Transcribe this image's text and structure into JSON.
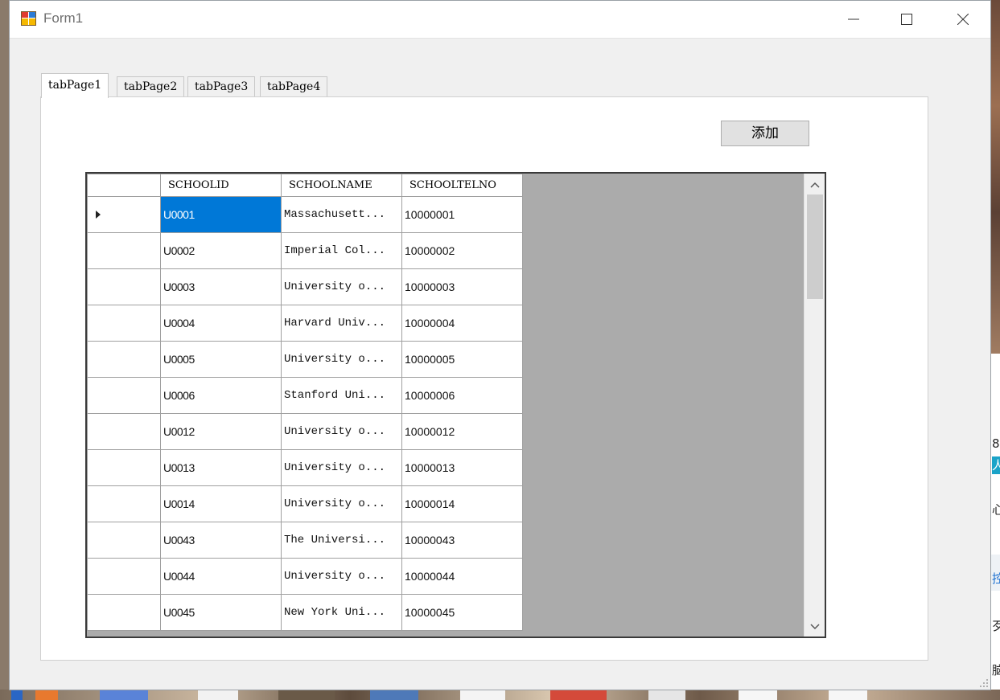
{
  "window": {
    "title": "Form1"
  },
  "tabs": [
    {
      "label": "tabPage1",
      "active": true
    },
    {
      "label": "tabPage2",
      "active": false
    },
    {
      "label": "tabPage3",
      "active": false
    },
    {
      "label": "tabPage4",
      "active": false
    }
  ],
  "toolbar": {
    "add_label": "添加"
  },
  "grid": {
    "columns": [
      "SCHOOLID",
      "SCHOOLNAME",
      "SCHOOLTELNO"
    ],
    "selected_row": 0,
    "selection_color": "#0078d7",
    "rows": [
      {
        "id": "U0001",
        "name": "Massachusett...",
        "tel": "10000001"
      },
      {
        "id": "U0002",
        "name": "Imperial Col...",
        "tel": "10000002"
      },
      {
        "id": "U0003",
        "name": "University o...",
        "tel": "10000003"
      },
      {
        "id": "U0004",
        "name": "Harvard Univ...",
        "tel": "10000004"
      },
      {
        "id": "U0005",
        "name": "University o...",
        "tel": "10000005"
      },
      {
        "id": "U0006",
        "name": "Stanford Uni...",
        "tel": "10000006"
      },
      {
        "id": "U0012",
        "name": "University o...",
        "tel": "10000012"
      },
      {
        "id": "U0013",
        "name": "University o...",
        "tel": "10000013"
      },
      {
        "id": "U0014",
        "name": "University o...",
        "tel": "10000014"
      },
      {
        "id": "U0043",
        "name": "The Universi...",
        "tel": "10000043"
      },
      {
        "id": "U0044",
        "name": "University o...",
        "tel": "10000044"
      },
      {
        "id": "U0045",
        "name": "New York Uni...",
        "tel": "10000045"
      }
    ]
  },
  "background_fragments": [
    "8",
    "人",
    "心",
    "控",
    "歹",
    "脑"
  ],
  "icons": {
    "app": "form-app-icon",
    "minimize": "minimize-icon",
    "maximize": "maximize-icon",
    "close": "close-icon",
    "scroll_up": "chevron-up-icon",
    "scroll_down": "chevron-down-icon",
    "row_indicator": "triangle-right-icon"
  }
}
